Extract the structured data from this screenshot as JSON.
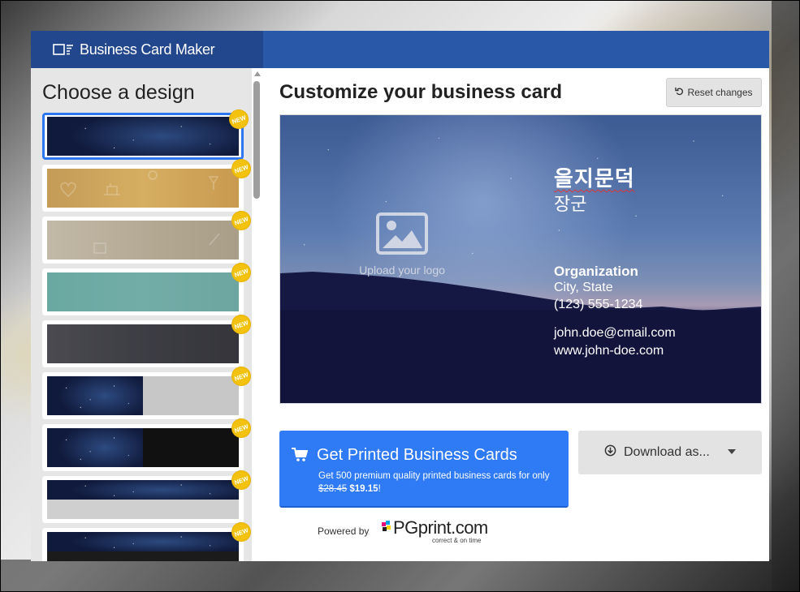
{
  "app": {
    "title": "Business Card Maker"
  },
  "sidebar": {
    "title": "Choose a design",
    "badge_label": "NEW",
    "designs": [
      {
        "style": "starry-night",
        "selected": true
      },
      {
        "style": "gold"
      },
      {
        "style": "taupe"
      },
      {
        "style": "teal"
      },
      {
        "style": "charcoal"
      },
      {
        "style": "stars-grey"
      },
      {
        "style": "stars-black"
      },
      {
        "style": "stars-silver"
      },
      {
        "style": "stars-dark"
      }
    ]
  },
  "main": {
    "title": "Customize your business card",
    "reset_label": "Reset changes"
  },
  "card": {
    "upload_label": "Upload your logo",
    "name": "을지문덕",
    "title": "장군",
    "organization": "Organization",
    "city": "City, State",
    "phone": "(123) 555-1234",
    "email": "john.doe@cmail.com",
    "website": "www.john-doe.com"
  },
  "print": {
    "label": "Get Printed Business Cards",
    "description": "Get 500 premium quality printed business cards for only",
    "old_price": "$28.45",
    "new_price": "$19.15",
    "suffix": "!"
  },
  "download": {
    "label": "Download as..."
  },
  "footer": {
    "powered_by": "Powered by",
    "brand": "PGprint.com",
    "tagline": "correct & on time"
  },
  "colors": {
    "header": "#2a58a8",
    "brand_bar": "#23478c",
    "primary_button": "#2f7af5",
    "badge": "#f3c20f",
    "selected_border": "#2f77f0"
  }
}
